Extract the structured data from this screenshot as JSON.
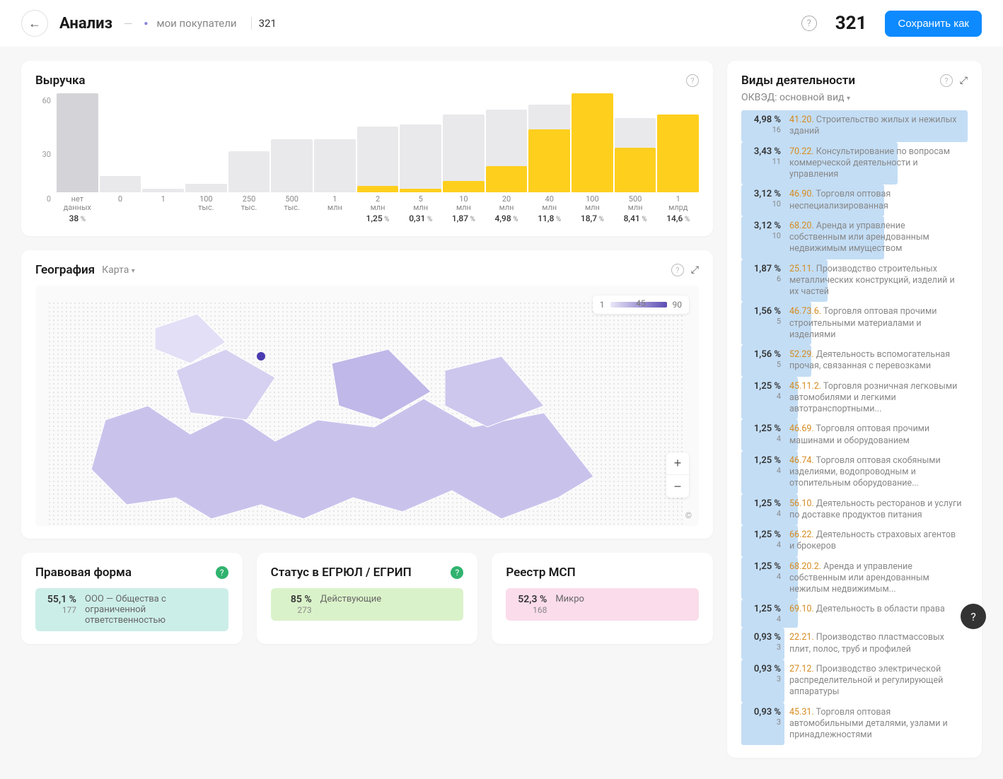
{
  "header": {
    "back": "←",
    "title": "Анализ",
    "segment_name": "мои покупатели",
    "segment_count": "321",
    "help": "?",
    "big_count": "321",
    "save_btn": "Сохранить как"
  },
  "revenue": {
    "title": "Выручка",
    "yticks": [
      "60",
      "30",
      "0"
    ],
    "nodata_label_top": "нет",
    "nodata_label_bot": "данных",
    "nodata_pct": "38"
  },
  "chart_data": {
    "type": "bar",
    "title": "Выручка",
    "ylabel": "",
    "ylim": [
      0,
      60
    ],
    "categories": [
      "нет данных",
      "0",
      "1",
      "100 тыс.",
      "250 тыс.",
      "500 тыс.",
      "1 млн",
      "2 млн",
      "5 млн",
      "10 млн",
      "20 млн",
      "40 млн",
      "100 млн",
      "500 млн",
      "1 млрд"
    ],
    "series": [
      {
        "name": "background",
        "values": [
          60,
          10,
          2,
          5,
          25,
          32,
          32,
          40,
          41,
          47,
          50,
          53,
          58,
          45,
          40
        ]
      },
      {
        "name": "selected",
        "values": [
          60,
          0,
          0,
          0,
          0,
          0,
          0,
          4,
          2,
          7,
          16,
          38,
          60,
          27,
          47
        ]
      }
    ],
    "percent_labels": [
      "38",
      "",
      "",
      "",
      "",
      "",
      "",
      "1,25",
      "0,31",
      "1,87",
      "4,98",
      "11,8",
      "18,7",
      "8,41",
      "14,6"
    ]
  },
  "geo": {
    "title": "География",
    "mode": "Карта",
    "legend_min": "1",
    "legend_mid": "45",
    "legend_max": "90",
    "zoom_in": "+",
    "zoom_out": "−",
    "copy": "©"
  },
  "legal": {
    "title": "Правовая форма",
    "rows": [
      {
        "pct": "55,1 %",
        "cnt": "177",
        "txt": "ООО — Общества с ограниченной ответственностью",
        "bg": "bg-teal"
      }
    ]
  },
  "status": {
    "title": "Статус в ЕГРЮЛ / ЕГРИП",
    "rows": [
      {
        "pct": "85 %",
        "cnt": "273",
        "txt": "Действующие",
        "bg": "bg-green"
      }
    ]
  },
  "msp": {
    "title": "Реестр МСП",
    "rows": [
      {
        "pct": "52,3 %",
        "cnt": "168",
        "txt": "Микро",
        "bg": "bg-pink"
      }
    ]
  },
  "activities": {
    "title": "Виды деятельности",
    "sub": "ОКВЭД: основной вид",
    "rows": [
      {
        "pct": "4,98 %",
        "cnt": "16",
        "code": "41.20.",
        "txt": "Строительство жилых и нежилых зданий",
        "bar": 100
      },
      {
        "pct": "3,43 %",
        "cnt": "11",
        "code": "70.22.",
        "txt": "Консультирование по вопросам коммерческой деятельности и управления",
        "bar": 69
      },
      {
        "pct": "3,12 %",
        "cnt": "10",
        "code": "46.90.",
        "txt": "Торговля оптовая неспециализированная",
        "bar": 63
      },
      {
        "pct": "3,12 %",
        "cnt": "10",
        "code": "68.20.",
        "txt": "Аренда и управление собственным или арендованным недвижимым имуществом",
        "bar": 63
      },
      {
        "pct": "1,87 %",
        "cnt": "6",
        "code": "25.11.",
        "txt": "Производство строительных металлических конструкций, изделий и их частей",
        "bar": 38
      },
      {
        "pct": "1,56 %",
        "cnt": "5",
        "code": "46.73.6.",
        "txt": "Торговля оптовая прочими строительными материалами и изделиями",
        "bar": 31
      },
      {
        "pct": "1,56 %",
        "cnt": "5",
        "code": "52.29.",
        "txt": "Деятельность вспомогательная прочая, связанная с перевозками",
        "bar": 31
      },
      {
        "pct": "1,25 %",
        "cnt": "4",
        "code": "45.11.2.",
        "txt": "Торговля розничная легковыми автомобилями и легкими автотранспортными...",
        "bar": 25
      },
      {
        "pct": "1,25 %",
        "cnt": "4",
        "code": "46.69.",
        "txt": "Торговля оптовая прочими машинами и оборудованием",
        "bar": 25
      },
      {
        "pct": "1,25 %",
        "cnt": "4",
        "code": "46.74.",
        "txt": "Торговля оптовая скобяными изделиями, водопроводным и отопительным оборудование...",
        "bar": 25
      },
      {
        "pct": "1,25 %",
        "cnt": "4",
        "code": "56.10.",
        "txt": "Деятельность ресторанов и услуги по доставке продуктов питания",
        "bar": 25
      },
      {
        "pct": "1,25 %",
        "cnt": "4",
        "code": "66.22.",
        "txt": "Деятельность страховых агентов и брокеров",
        "bar": 25
      },
      {
        "pct": "1,25 %",
        "cnt": "4",
        "code": "68.20.2.",
        "txt": "Аренда и управление собственным или арендованным нежилым недвижимым...",
        "bar": 25
      },
      {
        "pct": "1,25 %",
        "cnt": "4",
        "code": "69.10.",
        "txt": "Деятельность в области права",
        "bar": 25
      },
      {
        "pct": "0,93 %",
        "cnt": "3",
        "code": "22.21.",
        "txt": "Производство пластмассовых плит, полос, труб и профилей",
        "bar": 19
      },
      {
        "pct": "0,93 %",
        "cnt": "3",
        "code": "27.12.",
        "txt": "Производство электрической распределительной и регулирующей аппаратуры",
        "bar": 19
      },
      {
        "pct": "0,93 %",
        "cnt": "3",
        "code": "45.31.",
        "txt": "Торговля оптовая автомобильными деталями, узлами и принадлежностями",
        "bar": 19
      }
    ]
  }
}
